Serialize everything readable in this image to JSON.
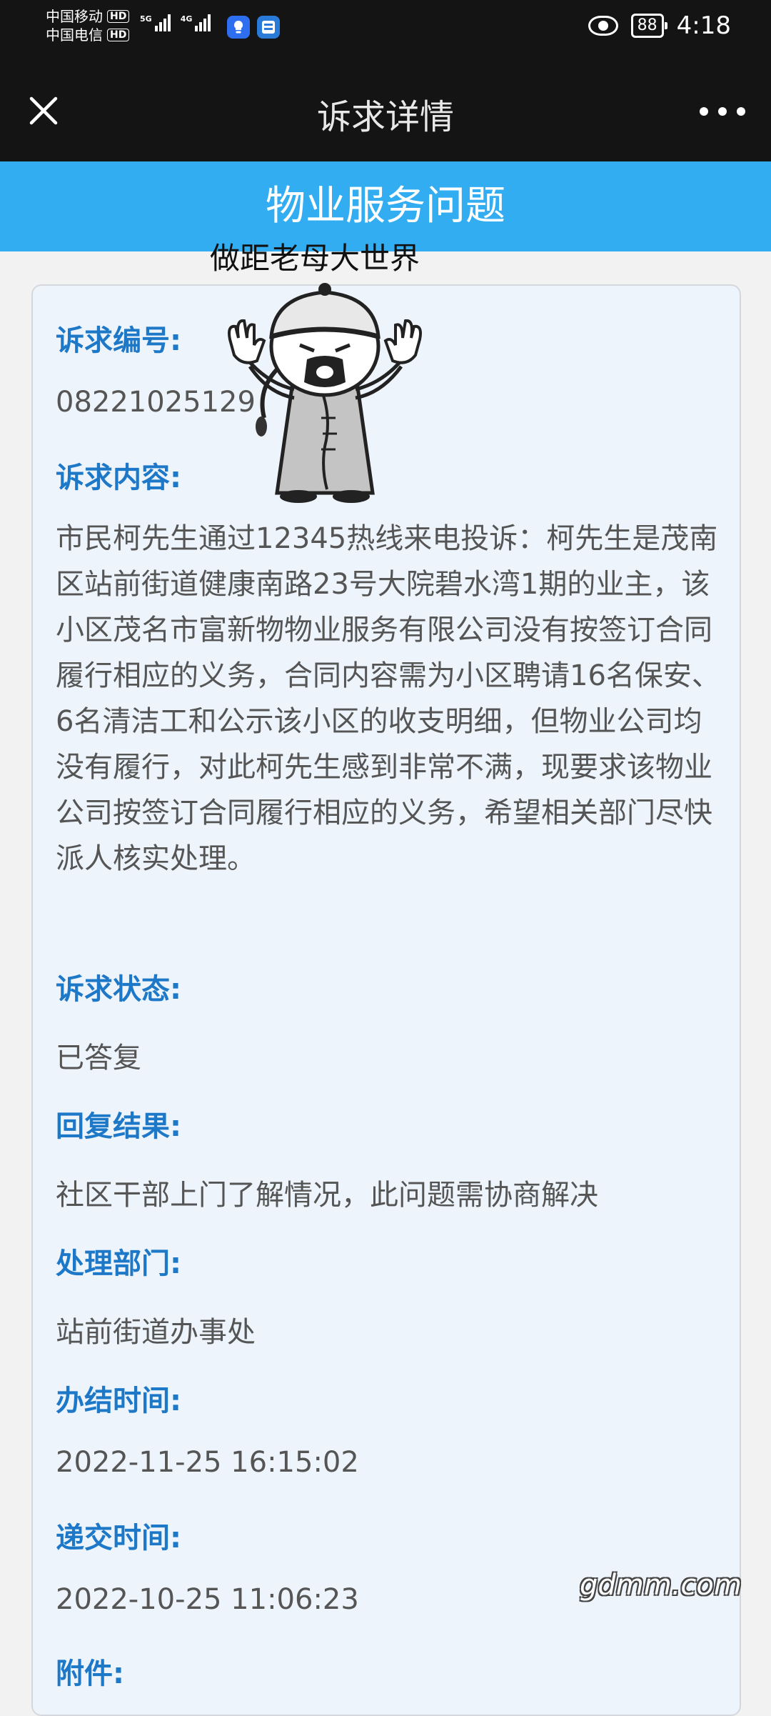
{
  "status_bar": {
    "carrier_1": "中国移动",
    "carrier_2": "中国电信",
    "hd": "HD",
    "signal_1": "5G",
    "signal_2": "4G",
    "battery": "88",
    "time": "4:18",
    "icons": [
      "eye-icon",
      "battery-icon",
      "app-icon"
    ]
  },
  "header": {
    "title": "诉求详情",
    "left_icon": "close-icon",
    "right_icon": "more-icon"
  },
  "banner": {
    "title": "物业服务问题"
  },
  "meme": {
    "caption": "做距老母大世界"
  },
  "detail": {
    "number_label": "诉求编号:",
    "number_value": "08221025129",
    "content_label": "诉求内容:",
    "content_value": "市民柯先生通过12345热线来电投诉：柯先生是茂南区站前街道健康南路23号大院碧水湾1期的业主，该小区茂名市富新物物业服务有限公司没有按签订合同履行相应的义务，合同内容需为小区聘请16名保安、6名清洁工和公示该小区的收支明细，但物业公司均没有履行，对此柯先生感到非常不满，现要求该物业公司按签订合同履行相应的义务，希望相关部门尽快派人核实处理。",
    "status_label": "诉求状态:",
    "status_value": "已答复",
    "reply_label": "回复结果:",
    "reply_value": "社区干部上门了解情况，此问题需协商解决",
    "dept_label": "处理部门:",
    "dept_value": "站前街道办事处",
    "finish_label": "办结时间:",
    "finish_value": "2022-11-25 16:15:02",
    "submit_label": "递交时间:",
    "submit_value": "2022-10-25 11:06:23",
    "attach_label": "附件:"
  },
  "watermark": "gdmm.com",
  "colors": {
    "banner": "#33adf2",
    "label": "#1e78c8",
    "card_bg": "#edf4fb",
    "header_bg": "#141414"
  }
}
